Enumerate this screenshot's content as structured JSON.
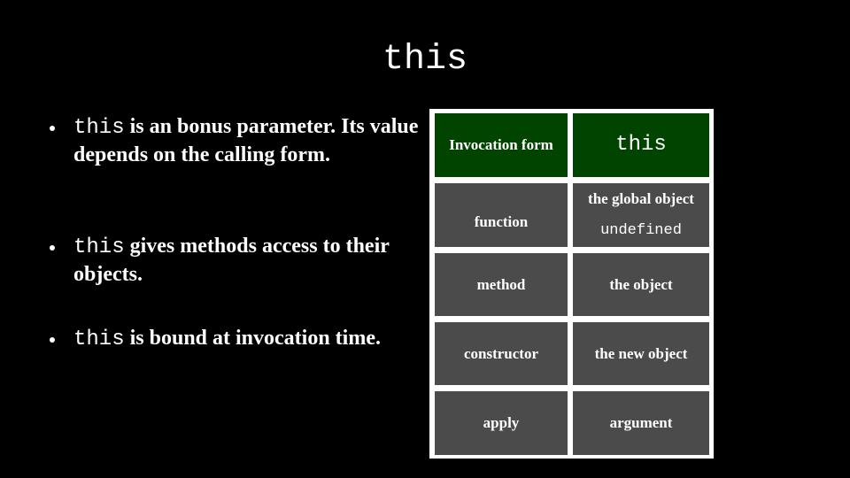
{
  "slide": {
    "title": "this",
    "background_color": "#000000",
    "text_color": "#ffffff"
  },
  "bullets": [
    {
      "code": "this",
      "text": " is an bonus parameter. Its value depends on the calling form."
    },
    {
      "code": "this",
      "text": " gives methods access to their objects."
    },
    {
      "code": "this",
      "text": " is bound at invocation time."
    }
  ],
  "table": {
    "header_color": "#004400",
    "cell_color": "#4b4b4b",
    "border_color": "#ffffff",
    "headers": [
      "Invocation form",
      "this"
    ],
    "rows": [
      {
        "form": "function",
        "value": "the global object",
        "value_note": "undefined"
      },
      {
        "form": "method",
        "value": "the object"
      },
      {
        "form": "constructor",
        "value": "the new object"
      },
      {
        "form": "apply",
        "value": "argument"
      }
    ]
  }
}
